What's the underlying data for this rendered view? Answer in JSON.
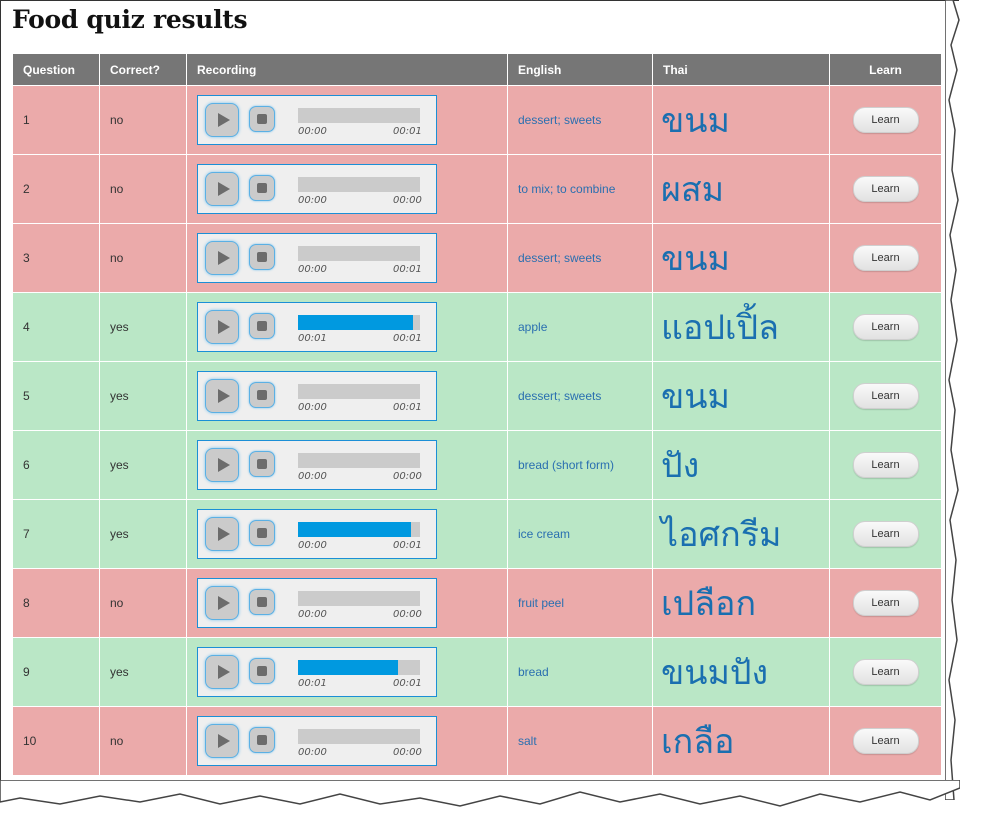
{
  "page": {
    "title": "Food quiz results"
  },
  "table": {
    "headers": {
      "question": "Question",
      "correct": "Correct?",
      "recording": "Recording",
      "english": "English",
      "thai": "Thai",
      "learn": "Learn"
    },
    "rows": [
      {
        "question": "1",
        "correct": "no",
        "status": "no",
        "progress": 0,
        "time_current": "00:00",
        "time_total": "00:01",
        "english": "dessert; sweets",
        "thai": "ขนม",
        "learn_label": "Learn"
      },
      {
        "question": "2",
        "correct": "no",
        "status": "no",
        "progress": 0,
        "time_current": "00:00",
        "time_total": "00:00",
        "english": "to mix; to combine",
        "thai": "ผสม",
        "learn_label": "Learn"
      },
      {
        "question": "3",
        "correct": "no",
        "status": "no",
        "progress": 0,
        "time_current": "00:00",
        "time_total": "00:01",
        "english": "dessert; sweets",
        "thai": "ขนม",
        "learn_label": "Learn"
      },
      {
        "question": "4",
        "correct": "yes",
        "status": "yes",
        "progress": 0.94,
        "time_current": "00:01",
        "time_total": "00:01",
        "english": "apple",
        "thai": "แอปเปิ้ล",
        "learn_label": "Learn"
      },
      {
        "question": "5",
        "correct": "yes",
        "status": "yes",
        "progress": 0,
        "time_current": "00:00",
        "time_total": "00:01",
        "english": "dessert; sweets",
        "thai": "ขนม",
        "learn_label": "Learn"
      },
      {
        "question": "6",
        "correct": "yes",
        "status": "yes",
        "progress": 0,
        "time_current": "00:00",
        "time_total": "00:00",
        "english": "bread (short form)",
        "thai": "ปัง",
        "learn_label": "Learn"
      },
      {
        "question": "7",
        "correct": "yes",
        "status": "yes",
        "progress": 0.93,
        "time_current": "00:00",
        "time_total": "00:01",
        "english": "ice cream",
        "thai": "ไอศกรีม",
        "learn_label": "Learn"
      },
      {
        "question": "8",
        "correct": "no",
        "status": "no",
        "progress": 0,
        "time_current": "00:00",
        "time_total": "00:00",
        "english": "fruit peel",
        "thai": "เปลือก",
        "learn_label": "Learn"
      },
      {
        "question": "9",
        "correct": "yes",
        "status": "yes",
        "progress": 0.82,
        "time_current": "00:01",
        "time_total": "00:01",
        "english": "bread",
        "thai": "ขนมปัง",
        "learn_label": "Learn"
      },
      {
        "question": "10",
        "correct": "no",
        "status": "no",
        "progress": 0,
        "time_current": "00:00",
        "time_total": "00:00",
        "english": "salt",
        "thai": "เกลือ",
        "learn_label": "Learn"
      }
    ]
  },
  "icons": {
    "play": "play-icon",
    "stop": "stop-icon"
  },
  "colors": {
    "incorrect_row": "#ebaaaa",
    "correct_row": "#bae7c6",
    "progress_fill": "#0099e0",
    "header_bg": "#767676",
    "link_text": "#2a6fb0"
  }
}
